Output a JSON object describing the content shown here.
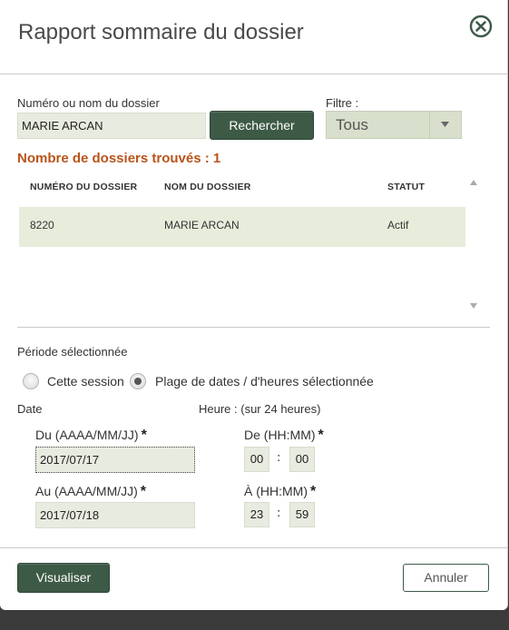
{
  "dialog": {
    "title": "Rapport sommaire du dossier",
    "close_icon": "close-circle-icon"
  },
  "search": {
    "label": "Numéro ou nom du dossier",
    "value": "MARIE ARCAN",
    "button_label": "Rechercher"
  },
  "filter": {
    "label": "Filtre :",
    "selected": "Tous"
  },
  "results": {
    "count_label": "Nombre de dossiers trouvés : 1",
    "columns": [
      "NUMÉRO DU DOSSIER",
      "NOM DU DOSSIER",
      "STATUT"
    ],
    "rows": [
      {
        "numero": "8220",
        "nom": "MARIE ARCAN",
        "statut": "Actif"
      }
    ]
  },
  "period": {
    "label": "Période sélectionnée",
    "options": [
      "Cette session",
      "Plage de dates / d'heures sélectionnée"
    ],
    "selected_index": 1,
    "date_label": "Date",
    "time_label": "Heure : (sur 24 heures)",
    "from_date_label": "Du (AAAA/MM/JJ)",
    "from_date_value": "2017/07/17",
    "to_date_label": "Au (AAAA/MM/JJ)",
    "to_date_value": "2017/07/18",
    "from_time_label": "De (HH:MM)",
    "from_hh": "00",
    "from_mm": "00",
    "to_time_label": "À (HH:MM)",
    "to_hh": "23",
    "to_mm": "59",
    "required_mark": "*",
    "time_separator": ":"
  },
  "footer": {
    "view_button": "Visualiser",
    "cancel_button": "Annuler"
  },
  "colors": {
    "accent_dark_green": "#3d5a47",
    "found_orange": "#b8541b",
    "field_bg": "#e8ebe0",
    "row_bg": "#e7ecdb"
  }
}
